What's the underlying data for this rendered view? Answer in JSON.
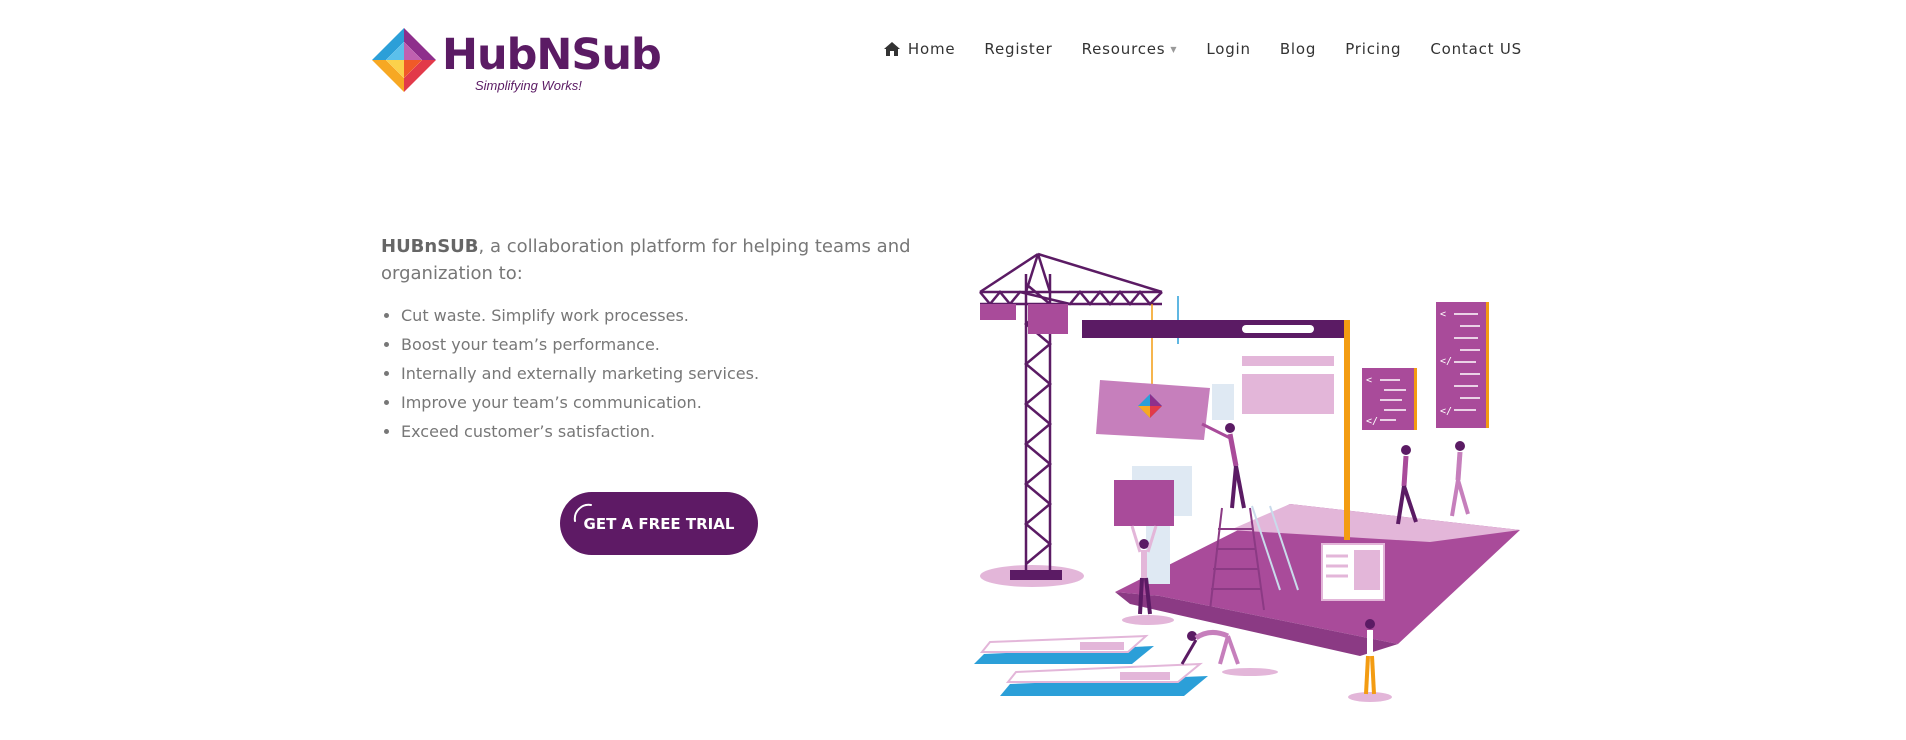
{
  "brand": {
    "name": "HubNSub",
    "tagline": "Simplifying Works!"
  },
  "nav": {
    "items": [
      {
        "label": "Home",
        "icon": "home-icon"
      },
      {
        "label": "Register"
      },
      {
        "label": "Resources",
        "icon": "caret-down-icon"
      },
      {
        "label": "Login"
      },
      {
        "label": "Blog"
      },
      {
        "label": "Pricing"
      },
      {
        "label": "Contact US"
      }
    ]
  },
  "hero": {
    "brand_bold": "HUBnSUB",
    "intro_rest": ", a collaboration platform for helping teams and organization to:",
    "features": [
      "Cut waste. Simplify work processes.",
      "Boost your team’s performance.",
      "Internally and externally marketing services.",
      "Improve your team’s communication.",
      "Exceed customer’s satisfaction."
    ],
    "cta_label": "GET A FREE TRIAL"
  },
  "colors": {
    "brand_purple": "#5b1b64",
    "accent_magenta": "#a94b9a",
    "light_pink": "#e3b6d9",
    "accent_orange": "#f39c12",
    "accent_blue": "#2b9fd8",
    "text_gray": "#777777"
  }
}
